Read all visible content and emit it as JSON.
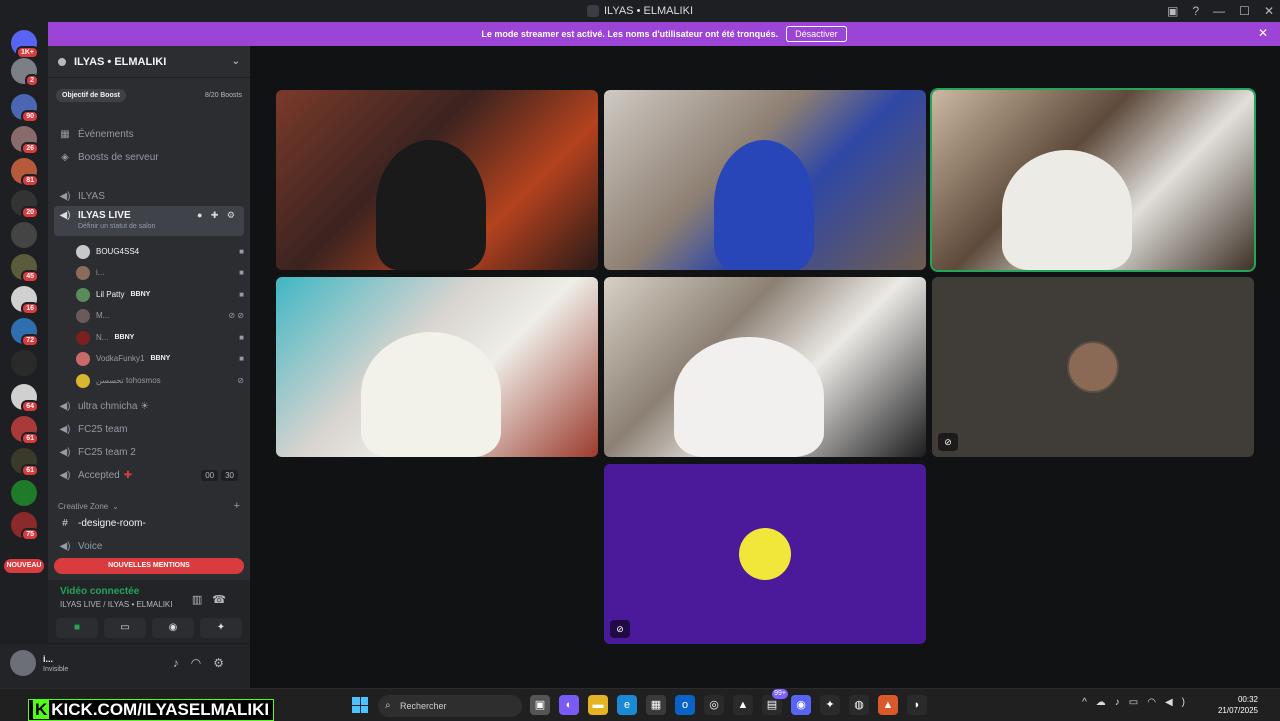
{
  "window": {
    "title": "ILYAS • ELMALIKI"
  },
  "banner": {
    "text": "Le mode streamer est activé. Les noms d'utilisateur ont été tronqués.",
    "button": "Désactiver"
  },
  "server_rail": {
    "badges": [
      "1K+",
      "2",
      "90",
      "26",
      "81",
      "20",
      "45",
      "16",
      "72",
      "64",
      "61",
      "61",
      "75"
    ],
    "new_label": "NOUVEAU"
  },
  "guild": {
    "name": "ILYAS • ELMALIKI",
    "boost_label": "Objectif de Boost",
    "boost_count": "8/20 Boosts",
    "events": "Événements",
    "server_boosts": "Boosts de serveur"
  },
  "channels": {
    "ilyas": "ILYAS",
    "live": "ILYAS LIVE",
    "live_status": "Définir un statut de salon",
    "users": [
      {
        "name": "BOUG4SS4",
        "tag": ""
      },
      {
        "name": "i...",
        "tag": ""
      },
      {
        "name": "Lil Patty",
        "tag": "BBNY"
      },
      {
        "name": "M...",
        "tag": ""
      },
      {
        "name": "N...",
        "tag": "BBNY"
      },
      {
        "name": "VodkaFunky1",
        "tag": "BBNY"
      },
      {
        "name": "تحسسن tohosmos",
        "tag": ""
      }
    ],
    "ultra": "ultra chmicha ☀",
    "fc25": "FC25 team",
    "fc25b": "FC25 team 2",
    "accepted": "Accepted",
    "accepted_counts": [
      "00",
      "30"
    ],
    "creative_zone": "Creative Zone",
    "designe_room": "-designe-room-",
    "voice": "Voice",
    "mentions_label": "NOUVELLES MENTIONS"
  },
  "voice_connection": {
    "status": "Vidéo connectée",
    "channel": "ILYAS LIVE / ILYAS • ELMALIKI"
  },
  "user": {
    "name": "i...",
    "status": "Invisible"
  },
  "taskbar": {
    "kick_text": "KICK.COM/ILYASELMALIKI",
    "search_placeholder": "Rechercher",
    "time": "00:32",
    "date": "21/07/2025",
    "notif_badge": "99+"
  },
  "colors": {
    "accent_banner": "#9b44d5",
    "connected_green": "#23a55a",
    "mention_red": "#d83c3e",
    "purple_tile": "#4a1a9a"
  }
}
